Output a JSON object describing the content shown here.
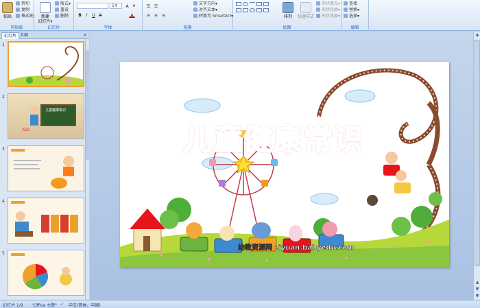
{
  "ribbon": {
    "groups": [
      {
        "label": "剪贴板"
      },
      {
        "label": "幻灯片"
      },
      {
        "label": "字体"
      },
      {
        "label": "段落"
      },
      {
        "label": "绘图"
      },
      {
        "label": "编辑"
      }
    ],
    "clipboard": {
      "paste": "粘贴",
      "cut": "剪切",
      "copy": "复制",
      "format_painter": "格式刷"
    },
    "slides": {
      "new_slide_line1": "新建",
      "new_slide_line2": "幻灯片▾",
      "layout": "版式▾",
      "reset": "重设",
      "delete": "删除"
    },
    "font": {
      "size": "14",
      "grow": "A",
      "shrink": "A",
      "bold": "B",
      "italic": "I",
      "underline": "U",
      "strike": "S",
      "color": "A"
    },
    "paragraph": {
      "text_direction": "文字方向▾",
      "align_text": "对齐文本▾",
      "smartart": "转换为 SmartArt▾"
    },
    "drawing": {
      "arrange": "排列",
      "quick_styles": "快速样式",
      "shape_fill": "形状填充▾",
      "shape_outline": "形状轮廓▾",
      "shape_effects": "形状效果▾"
    },
    "editing": {
      "find": "查找",
      "replace": "替换▾",
      "select": "选择▾"
    }
  },
  "panel": {
    "tab_slides": "幻灯片",
    "tab_outline": "大纲",
    "close": "×",
    "slides": [
      {
        "number": "1",
        "title": "儿童健康常识"
      },
      {
        "number": "2",
        "title": "儿童健康常识"
      },
      {
        "number": "3",
        "title": ""
      },
      {
        "number": "4",
        "title": ""
      },
      {
        "number": "5",
        "title": ""
      }
    ]
  },
  "slide": {
    "title": "儿童健康常识",
    "watermark": "幼教资源网 ziyuan.babyedu.com"
  },
  "status": {
    "slide_info": "幻灯片 1/9",
    "theme": "\"Office 主题\"",
    "language": "中文(简体，中国)"
  },
  "colors": {
    "title_red": "#e8141c",
    "track_brown": "#8a4a2e",
    "grass": "#b6d83a",
    "ribbon_bg": "#dbe7f6"
  }
}
